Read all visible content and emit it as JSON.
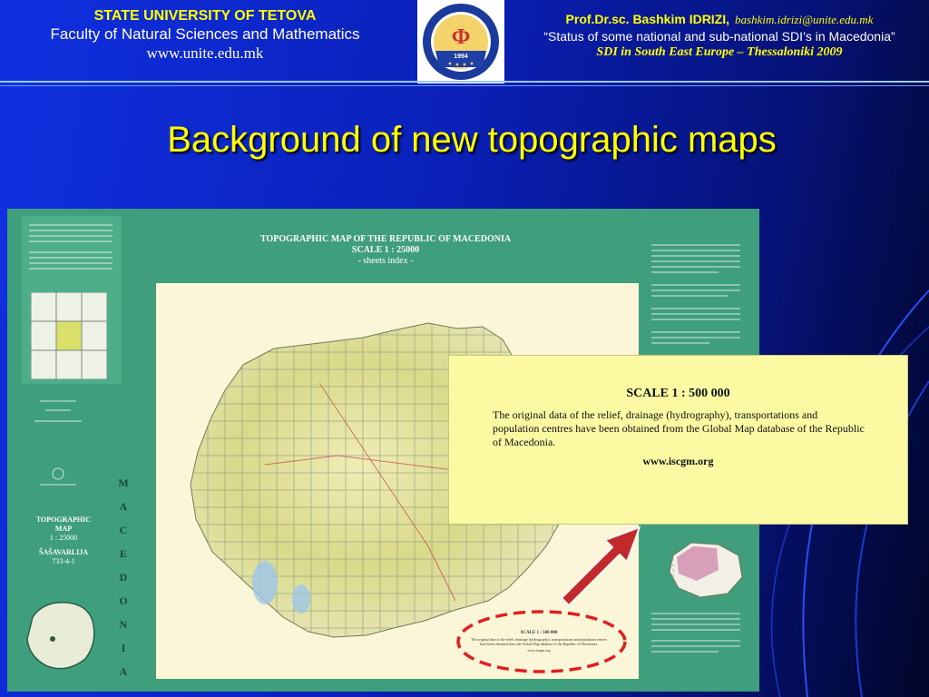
{
  "header": {
    "university": "STATE UNIVERSITY OF TETOVA",
    "faculty": "Faculty of Natural Sciences and Mathematics",
    "website": "www.unite.edu.mk",
    "logo_year": "1994",
    "author": "Prof.Dr.sc. Bashkim IDRIZI,",
    "email": "bashkim.idrizi@unite.edu.mk",
    "talk_title": "“Status of some national and sub-national SDI’s  in Macedonia”",
    "event": "SDI in South East Europe – Thessaloniki 2009"
  },
  "slide": {
    "title": "Background of new topographic maps"
  },
  "map_sheet": {
    "title_line1": "TOPOGRAPHIC MAP OF THE REPUBLIC OF MACEDONIA",
    "title_line2": "SCALE 1 : 25000",
    "title_line3": "- sheets index -",
    "side_title": "TOPOGRAPHIC MAP",
    "side_scale": "1 : 25000",
    "side_sheet": "ŠAŠAVARLIJA",
    "side_code": "733-4-1",
    "vertical_letters": [
      "M",
      "A",
      "C",
      "E",
      "D",
      "O",
      "N",
      "I",
      "A"
    ]
  },
  "callout": {
    "title": "SCALE 1 : 500 000",
    "body": "The original data of the relief, drainage (hydrography), transportations and population centres have been obtained from the Global Map database of the Republic of Macedonia.",
    "url": "www.iscgm.org"
  },
  "small_box": {
    "title": "SCALE 1 : 500 000",
    "body": "The original data of the relief, drainage (hydrography), transportations and population centres have been obtained from the Global Map database of the Republic of Macedonia.",
    "url": "www.iscgm.org"
  },
  "colors": {
    "background": "#0a20b8",
    "title": "#ffff00",
    "map_green": "#3f9e7c",
    "callout_bg": "#fbf9a2",
    "ellipse": "#e02020",
    "arrow": "#c02a2a"
  }
}
